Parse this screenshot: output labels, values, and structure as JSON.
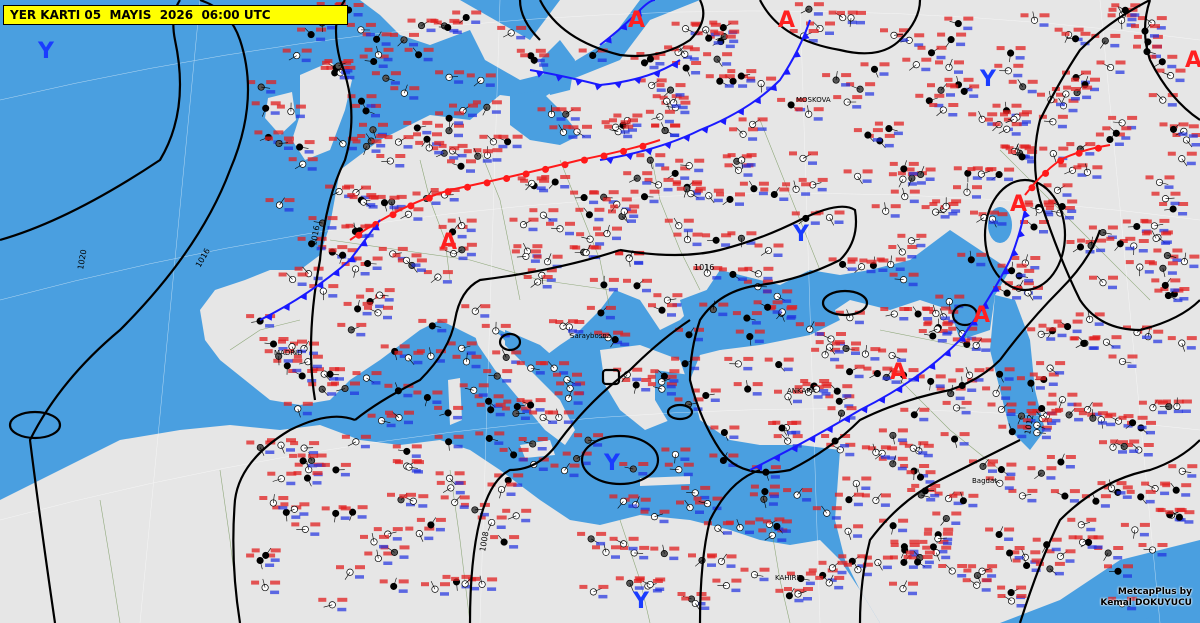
{
  "title": "YER KARTI 05  MAYIS  2026  06:00 UTC",
  "credit": {
    "line1": "MetcapPlus by",
    "line2": "Kemal DOKUYUCU"
  },
  "pressure_centers": [
    {
      "id": "y-atlantic",
      "label": "Y",
      "kind": "low"
    },
    {
      "id": "a-scandinavia",
      "label": "A",
      "kind": "high"
    },
    {
      "id": "a-finland",
      "label": "A",
      "kind": "high"
    },
    {
      "id": "a-nurals",
      "label": "A",
      "kind": "high"
    },
    {
      "id": "y-russia",
      "label": "Y",
      "kind": "low"
    },
    {
      "id": "a-central",
      "label": "A",
      "kind": "high"
    },
    {
      "id": "y-ukraine",
      "label": "Y",
      "kind": "low"
    },
    {
      "id": "a-volga",
      "label": "A",
      "kind": "high"
    },
    {
      "id": "a-caspian",
      "label": "A",
      "kind": "high"
    },
    {
      "id": "a-anatolia",
      "label": "A",
      "kind": "high"
    },
    {
      "id": "y-ionian",
      "label": "Y",
      "kind": "low"
    },
    {
      "id": "y-libya",
      "label": "Y",
      "kind": "low"
    }
  ],
  "isobar_labels": [
    {
      "id": "iso-1020",
      "text": "1020"
    },
    {
      "id": "iso-1016a",
      "text": "1016"
    },
    {
      "id": "iso-1016b",
      "text": "1016"
    },
    {
      "id": "iso-1016c",
      "text": "1016"
    },
    {
      "id": "iso-1012",
      "text": "1012"
    },
    {
      "id": "iso-1008",
      "text": "1008"
    }
  ],
  "cities": [
    {
      "id": "madrid",
      "text": "MADRID"
    },
    {
      "id": "ankara",
      "text": "ANKARA"
    },
    {
      "id": "kahire",
      "text": "KAHIRE"
    },
    {
      "id": "bagdat",
      "text": "Bagdat"
    },
    {
      "id": "saraybosna",
      "text": "Saraybosna"
    },
    {
      "id": "moskova",
      "text": "MOSKOVA"
    }
  ],
  "colors": {
    "sea": "#4a9fe0",
    "land": "#e6e6e6",
    "isobar": "#000000",
    "cold_front": "#1a1aff",
    "warm_front": "#ff1a1a",
    "high_center": "#ff2020",
    "low_center": "#1a3cff",
    "title_bg": "#ffff00"
  }
}
